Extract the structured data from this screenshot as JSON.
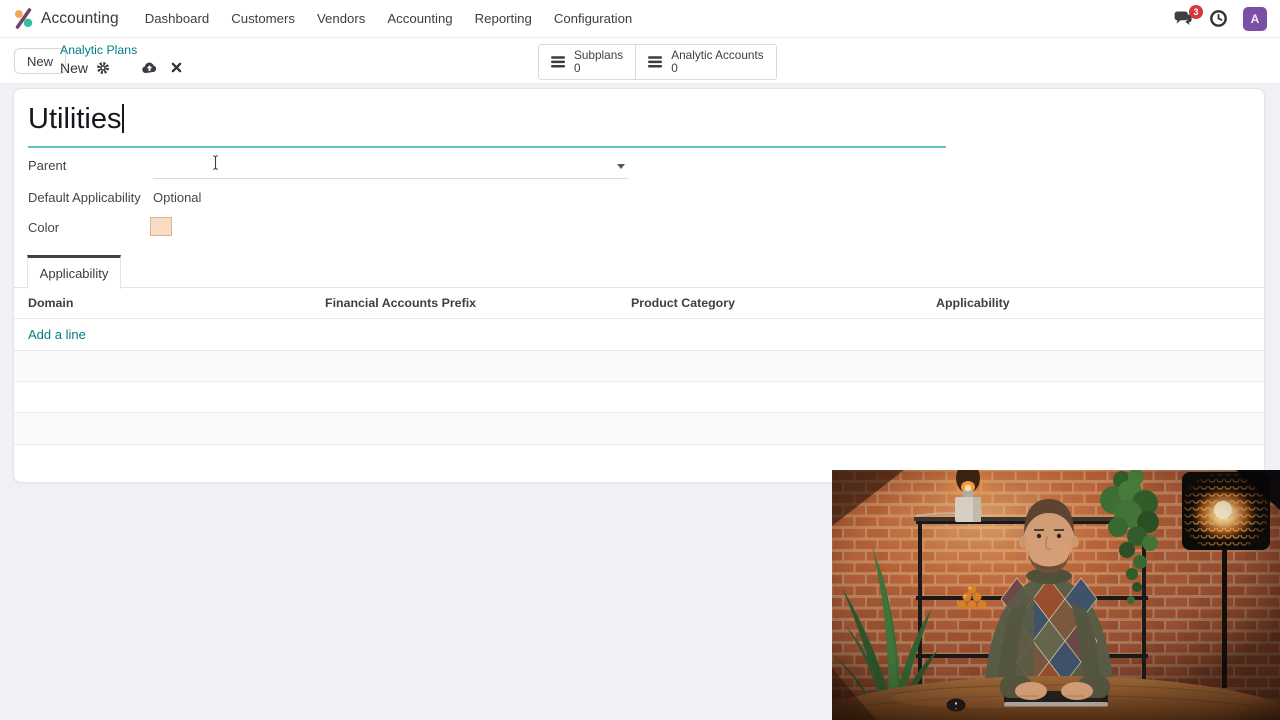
{
  "app": {
    "name": "Accounting"
  },
  "nav": {
    "items": [
      "Dashboard",
      "Customers",
      "Vendors",
      "Accounting",
      "Reporting",
      "Configuration"
    ]
  },
  "systray": {
    "messages_badge": "3",
    "avatar_letter": "A",
    "icons": {
      "messages": "chat-bubbles-icon",
      "activity": "clock-icon"
    }
  },
  "control_panel": {
    "new_button_label": "New",
    "breadcrumb_parent": "Analytic Plans",
    "breadcrumb_current": "New",
    "icons": {
      "settings": "gear-icon",
      "save": "cloud-upload-icon",
      "discard": "x-icon"
    },
    "stat_buttons": [
      {
        "label": "Subplans",
        "value": "0",
        "icon": "list-bars-icon"
      },
      {
        "label": "Analytic Accounts",
        "value": "0",
        "icon": "list-bars-icon"
      }
    ]
  },
  "form": {
    "title_value": "Utilities",
    "fields": {
      "parent": {
        "label": "Parent",
        "value": "",
        "icon": "caret-down-icon"
      },
      "default_applicability": {
        "label": "Default Applicability",
        "value": "Optional"
      },
      "color": {
        "label": "Color",
        "swatch_hex": "#f9dcc4"
      }
    },
    "tabs": [
      {
        "label": "Applicability",
        "active": true
      }
    ],
    "applicability_table": {
      "columns": [
        "Domain",
        "Financial Accounts Prefix",
        "Product Category",
        "Applicability"
      ],
      "add_line_label": "Add a line",
      "rows": []
    }
  },
  "video_overlay": {
    "description": "Presenter webcam: man in argyle sweater at a wooden desk, brick wall, glowing lamps and plants"
  },
  "colors": {
    "accent_teal": "#017e84",
    "title_underline": "#64c1bf",
    "badge_red": "#d7373f",
    "avatar_purple": "#7b4fa5",
    "page_bg": "#f0f1f4",
    "color_swatch": "#f9dcc4"
  }
}
